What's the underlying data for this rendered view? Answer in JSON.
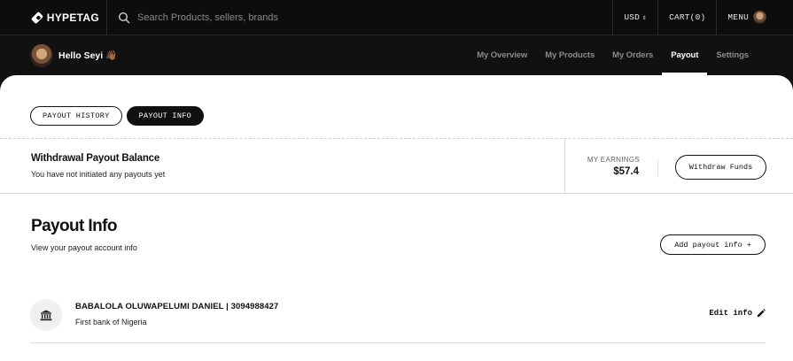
{
  "brand": {
    "name": "HYPETAG"
  },
  "search": {
    "placeholder": "Search Products, sellers, brands"
  },
  "topbar": {
    "currency": "USD",
    "cart": "CART(0)",
    "menu": "MENU"
  },
  "greeting": "Hello Seyi 👋🏾",
  "nav": [
    {
      "label": "My Overview",
      "active": false
    },
    {
      "label": "My Products",
      "active": false
    },
    {
      "label": "My Orders",
      "active": false
    },
    {
      "label": "Payout",
      "active": true
    },
    {
      "label": "Settings",
      "active": false
    }
  ],
  "tabs": [
    {
      "label": "PAYOUT HISTORY",
      "active": false
    },
    {
      "label": "PAYOUT INFO",
      "active": true
    }
  ],
  "balance": {
    "title": "Withdrawal Payout Balance",
    "subtitle": "You have not initiated any payouts yet",
    "earnings_label": "MY EARNINGS",
    "earnings_value": "$57.4",
    "withdraw_label": "Withdraw Funds"
  },
  "payout_info": {
    "title": "Payout Info",
    "subtitle": "View your payout account info",
    "add_label": "Add payout info",
    "add_symbol": "+"
  },
  "account": {
    "name_number": "BABALOLA OLUWAPELUMI DANIEL | 3094988427",
    "bank": "First bank of Nigeria",
    "edit_label": "Edit info"
  },
  "icons": {
    "logo": "diamond-logo-icon",
    "search": "search-icon",
    "currency": "chevron-updown-icon",
    "bank": "bank-icon",
    "edit": "pencil-icon"
  },
  "colors": {
    "dark": "#111111",
    "white": "#ffffff",
    "muted": "#8b8b8b"
  }
}
